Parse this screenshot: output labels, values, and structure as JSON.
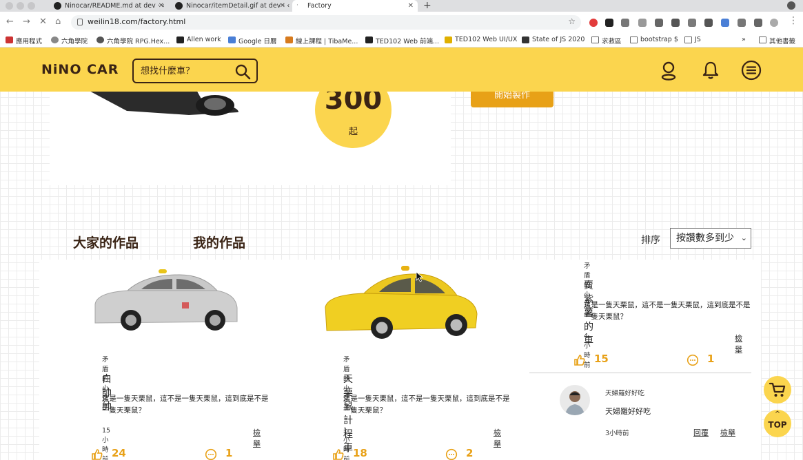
{
  "browser": {
    "tabs": [
      {
        "title": "Ninocar/README.md at dev · ‹"
      },
      {
        "title": "Ninocar/itemDetail.gif at dev · ‹"
      },
      {
        "title": "Factory"
      }
    ],
    "url": "weilin18.com/factory.html",
    "bookmarks": [
      "應用程式",
      "六角學院",
      "六角學院 RPG.Hex...",
      "Allen work",
      "Google 日曆",
      "線上課程 | TibaMe...",
      "TED102 Web 前端...",
      "TED102 Web UI/UX",
      "State of JS 2020",
      "求救區",
      "bootstrap $",
      "JS",
      "其他書籤"
    ]
  },
  "header": {
    "logo": "NiNO CAR",
    "search_placeholder": "想找什麼車？",
    "icons": [
      "search-icon",
      "user-icon",
      "bell-icon",
      "menu-icon"
    ]
  },
  "hero": {
    "price": "300",
    "price_unit": "起",
    "start_button": "開始製作"
  },
  "tabs": {
    "all_works": "大家的作品",
    "my_works": "我的作品"
  },
  "sort": {
    "label": "排序",
    "selected": "按讚數多到少"
  },
  "works": [
    {
      "author": "矛盾的小女子",
      "title": "白帥帥",
      "desc": "這是一隻天栗鼠，這不是一隻天栗鼠，這到底是不是一隻天栗鼠？",
      "time": "15小時前",
      "report": "檢舉",
      "likes": "24",
      "comments": "1",
      "car_color": "#c9c9c9"
    },
    {
      "author": "矛盾的小女子",
      "title": "天栗鼠計程車",
      "desc": "這是一隻天栗鼠，這不是一隻天栗鼠，這到底是不是一隻天栗鼠？",
      "time": "1小時前",
      "report": "檢舉",
      "likes": "18",
      "comments": "2",
      "car_color": "#e8c41a"
    },
    {
      "author": "矛盾的小女子",
      "title": "賣紫薯的車",
      "desc": "這是一隻天栗鼠，這不是一隻天栗鼠，這到底是不是一隻天栗鼠？",
      "time": "4小時前",
      "report": "檢舉",
      "likes": "15",
      "comments": "1"
    }
  ],
  "comment": {
    "name": "天婦羅好好吃",
    "text": "天婦羅好好吃",
    "time": "3小時前",
    "reply": "回覆",
    "report": "檢舉"
  },
  "float": {
    "top_label": "TOP"
  },
  "colors": {
    "brand_yellow": "#fbd54e",
    "accent_orange": "#e8a117",
    "dark_brown": "#3a2415"
  }
}
